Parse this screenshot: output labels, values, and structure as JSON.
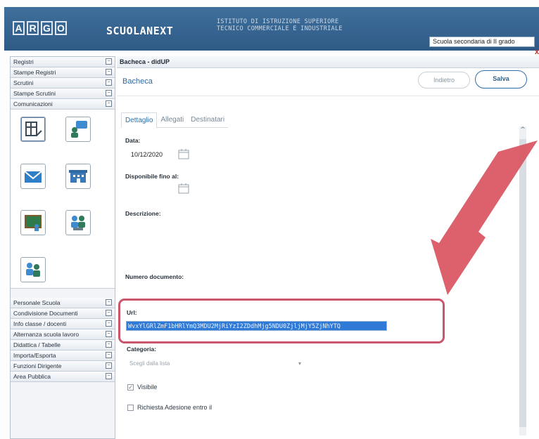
{
  "header": {
    "logo_letters": [
      "A",
      "R",
      "G",
      "O"
    ],
    "app_title": "SCUOLANEXT",
    "school_line1": "ISTITUTO DI ISTRUZIONE SUPERIORE",
    "school_line2": "TECNICO COMMERCIALE E INDUSTRIALE",
    "school_select_value": "Scuola secondaria di II grado",
    "close_glyph": "x"
  },
  "sidebar": {
    "top_items": [
      {
        "label": "Registri",
        "toggle": "−"
      },
      {
        "label": "Stampe Registri",
        "toggle": "−"
      },
      {
        "label": "Scrutini",
        "toggle": "−"
      },
      {
        "label": "Stampe Scrutini",
        "toggle": "−"
      },
      {
        "label": "Comunicazioni",
        "toggle": "−"
      }
    ],
    "icons": [
      "bacheca-icon",
      "messages-icon",
      "mail-icon",
      "school-building-icon",
      "class-board-icon",
      "meeting-group-icon",
      "teachers-group-icon"
    ],
    "bottom_items": [
      {
        "label": "Personale Scuola",
        "toggle": "−"
      },
      {
        "label": "Condivisione Documenti",
        "toggle": "−"
      },
      {
        "label": "Info classe / docenti",
        "toggle": "−"
      },
      {
        "label": "Alternanza scuola lavoro",
        "toggle": "−"
      },
      {
        "label": "Didattica / Tabelle",
        "toggle": "−"
      },
      {
        "label": "Importa/Esporta",
        "toggle": "−"
      },
      {
        "label": "Funzioni Dirigente",
        "toggle": "−"
      },
      {
        "label": "Area Pubblica",
        "toggle": "−"
      }
    ]
  },
  "main": {
    "window_title": "Bacheca - didUP",
    "breadcrumb": "Bacheca",
    "back_label": "Indietro",
    "save_label": "Salva",
    "tabs": [
      "Dettaglio",
      "Allegati",
      "Destinatari"
    ],
    "form": {
      "data_label": "Data:",
      "data_value": "10/12/2020",
      "disponibile_label": "Disponibile fino al:",
      "descrizione_label": "Descrizione:",
      "numero_label": "Numero documento:",
      "url_label": "Url:",
      "url_value": "WvxYlGRlZmF1bHRlYmQ3MDU2MjRiYzI2ZDdhMjg5NDU0ZjljMjY5ZjNhYTQ",
      "categoria_label": "Categoria:",
      "categoria_placeholder": "Scegli dalla lista",
      "visibile_label": "Visibile",
      "visibile_checked": true,
      "adesione_label": "Richiesta Adesione entro il",
      "adesione_checked": false
    }
  },
  "colors": {
    "header_blue": "#3f6f9c",
    "accent_blue": "#2f6ea8",
    "highlight_red": "#c9566a",
    "url_selection": "#2f7ad6"
  }
}
